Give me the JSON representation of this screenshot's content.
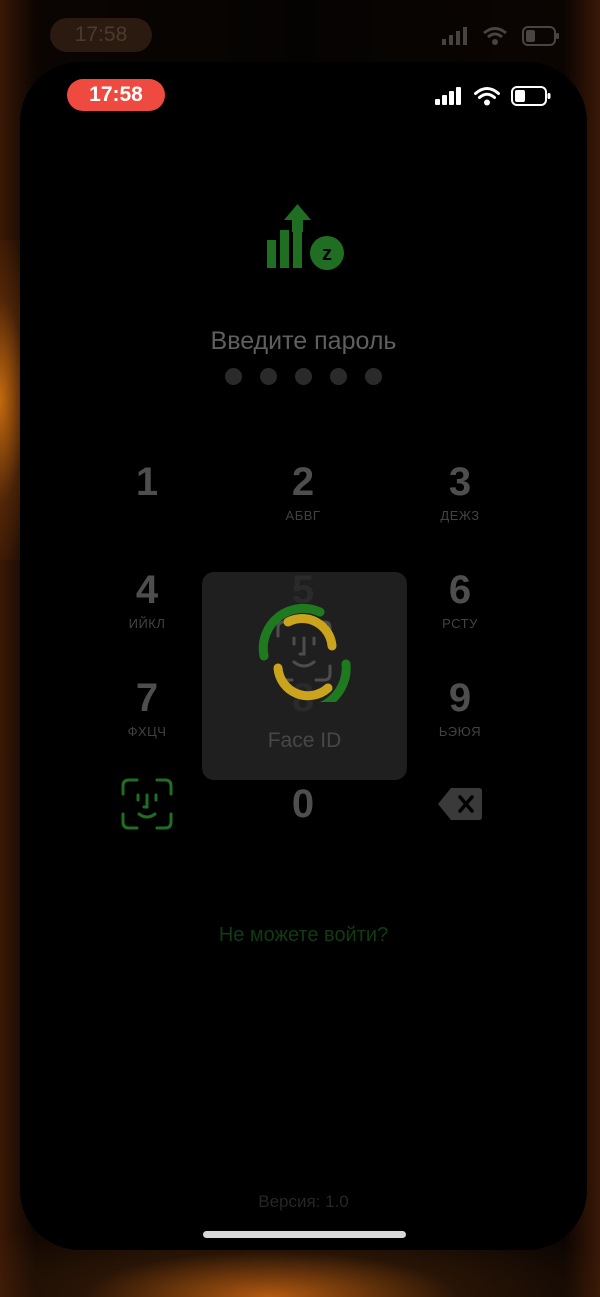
{
  "outer_status": {
    "time": "17:58"
  },
  "status_bar": {
    "time": "17:58"
  },
  "passcode": {
    "prompt": "Введите пароль",
    "dot_count": 5
  },
  "keypad": [
    {
      "number": "1",
      "letters": ""
    },
    {
      "number": "2",
      "letters": "АБВГ"
    },
    {
      "number": "3",
      "letters": "ДЕЖЗ"
    },
    {
      "number": "4",
      "letters": "ИЙКЛ"
    },
    {
      "number": "5",
      "letters": ""
    },
    {
      "number": "6",
      "letters": "РСТУ"
    },
    {
      "number": "7",
      "letters": "ФХЦЧ"
    },
    {
      "number": "8",
      "letters": ""
    },
    {
      "number": "9",
      "letters": "ЬЭЮЯ"
    },
    {
      "number": "0",
      "letters": ""
    }
  ],
  "faceid_overlay": {
    "label": "Face ID"
  },
  "links": {
    "forgot": "Не можете войти?"
  },
  "footer": {
    "version": "Версия: 1.0"
  },
  "colors": {
    "brand_green": "#1f6e22",
    "brand_yellow": "#c9a41c",
    "recording_red": "#ef4a40"
  },
  "icons": {
    "logo": "app-logo-chart-arrow-z",
    "biometric_button": "face-id-icon",
    "delete_button": "backspace-icon",
    "signal": "cellular-signal-icon",
    "wifi": "wifi-icon",
    "battery": "battery-icon"
  }
}
